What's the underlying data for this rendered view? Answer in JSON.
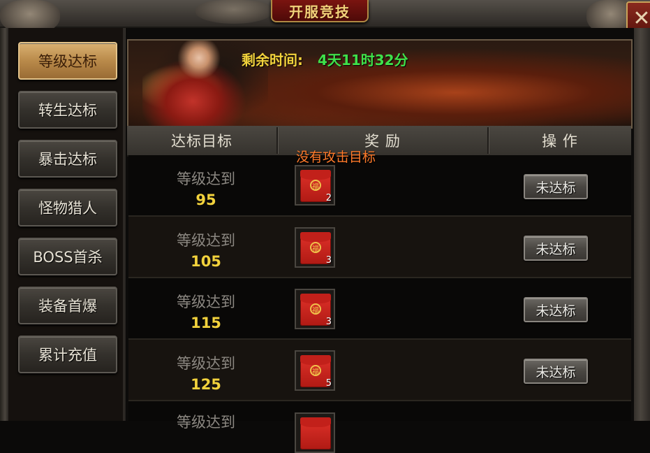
{
  "window": {
    "title": "开服竞技",
    "close_icon": "close-icon"
  },
  "sidebar": {
    "items": [
      {
        "label": "等级达标",
        "active": true
      },
      {
        "label": "转生达标",
        "active": false
      },
      {
        "label": "暴击达标",
        "active": false
      },
      {
        "label": "怪物猎人",
        "active": false
      },
      {
        "label": "BOSS首杀",
        "active": false
      },
      {
        "label": "装备首爆",
        "active": false
      },
      {
        "label": "累计充值",
        "active": false
      }
    ]
  },
  "banner": {
    "remaining_label": "剩余时间:",
    "remaining_value": "4天11时32分"
  },
  "table": {
    "headers": [
      "达标目标",
      "奖 励",
      "操 作"
    ],
    "rows": [
      {
        "condition": "等级达到",
        "level": "95",
        "reward_icon": "red-envelope-icon",
        "reward_count": "2",
        "action": "未达标"
      },
      {
        "condition": "等级达到",
        "level": "105",
        "reward_icon": "red-envelope-icon",
        "reward_count": "3",
        "action": "未达标"
      },
      {
        "condition": "等级达到",
        "level": "115",
        "reward_icon": "red-envelope-icon",
        "reward_count": "3",
        "action": "未达标"
      },
      {
        "condition": "等级达到",
        "level": "125",
        "reward_icon": "red-envelope-icon",
        "reward_count": "5",
        "action": "未达标"
      },
      {
        "condition": "等级达到",
        "level": "",
        "reward_icon": "red-envelope-icon",
        "reward_count": "",
        "action": ""
      }
    ]
  },
  "hint_text": "没有攻击目标",
  "colors": {
    "timer_label": "#f2d23c",
    "timer_value": "#3fe04a",
    "level_value": "#f2d23c",
    "hint": "#ff7a2a",
    "active_tab": "#c39a58"
  }
}
